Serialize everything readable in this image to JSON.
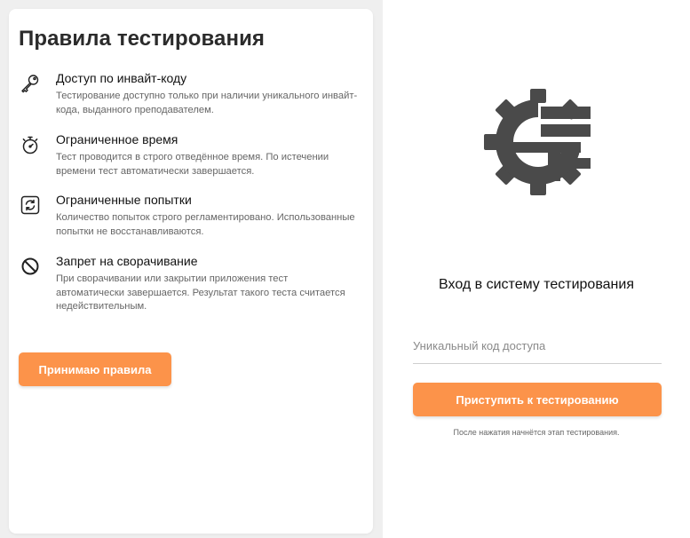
{
  "rules": {
    "title": "Правила тестирования",
    "items": [
      {
        "icon": "key-icon",
        "title": "Доступ по инвайт-коду",
        "description": "Тестирование доступно только при наличии уникального инвайт-кода, выданного преподавателем."
      },
      {
        "icon": "stopwatch-icon",
        "title": "Ограниченное время",
        "description": "Тест проводится в строго отведённое время. По истечении времени тест автоматически завершается."
      },
      {
        "icon": "refresh-icon",
        "title": "Ограниченные попытки",
        "description": "Количество попыток строго регламентировано. Использованные попытки не восстанавливаются."
      },
      {
        "icon": "block-icon",
        "title": "Запрет на сворачивание",
        "description": "При сворачивании или закрытии приложения тест автоматически завершается. Результат такого теста считается недействительным."
      }
    ],
    "accept_label": "Принимаю правила"
  },
  "login": {
    "title": "Вход в систему тестирования",
    "code_placeholder": "Уникальный код доступа",
    "code_value": "",
    "start_label": "Приступить к тестированию",
    "note": "После нажатия начнётся этап тестирования."
  },
  "colors": {
    "accent": "#fc934a",
    "background": "#efefef",
    "panel": "#ffffff",
    "logo": "#4a4a4a"
  }
}
